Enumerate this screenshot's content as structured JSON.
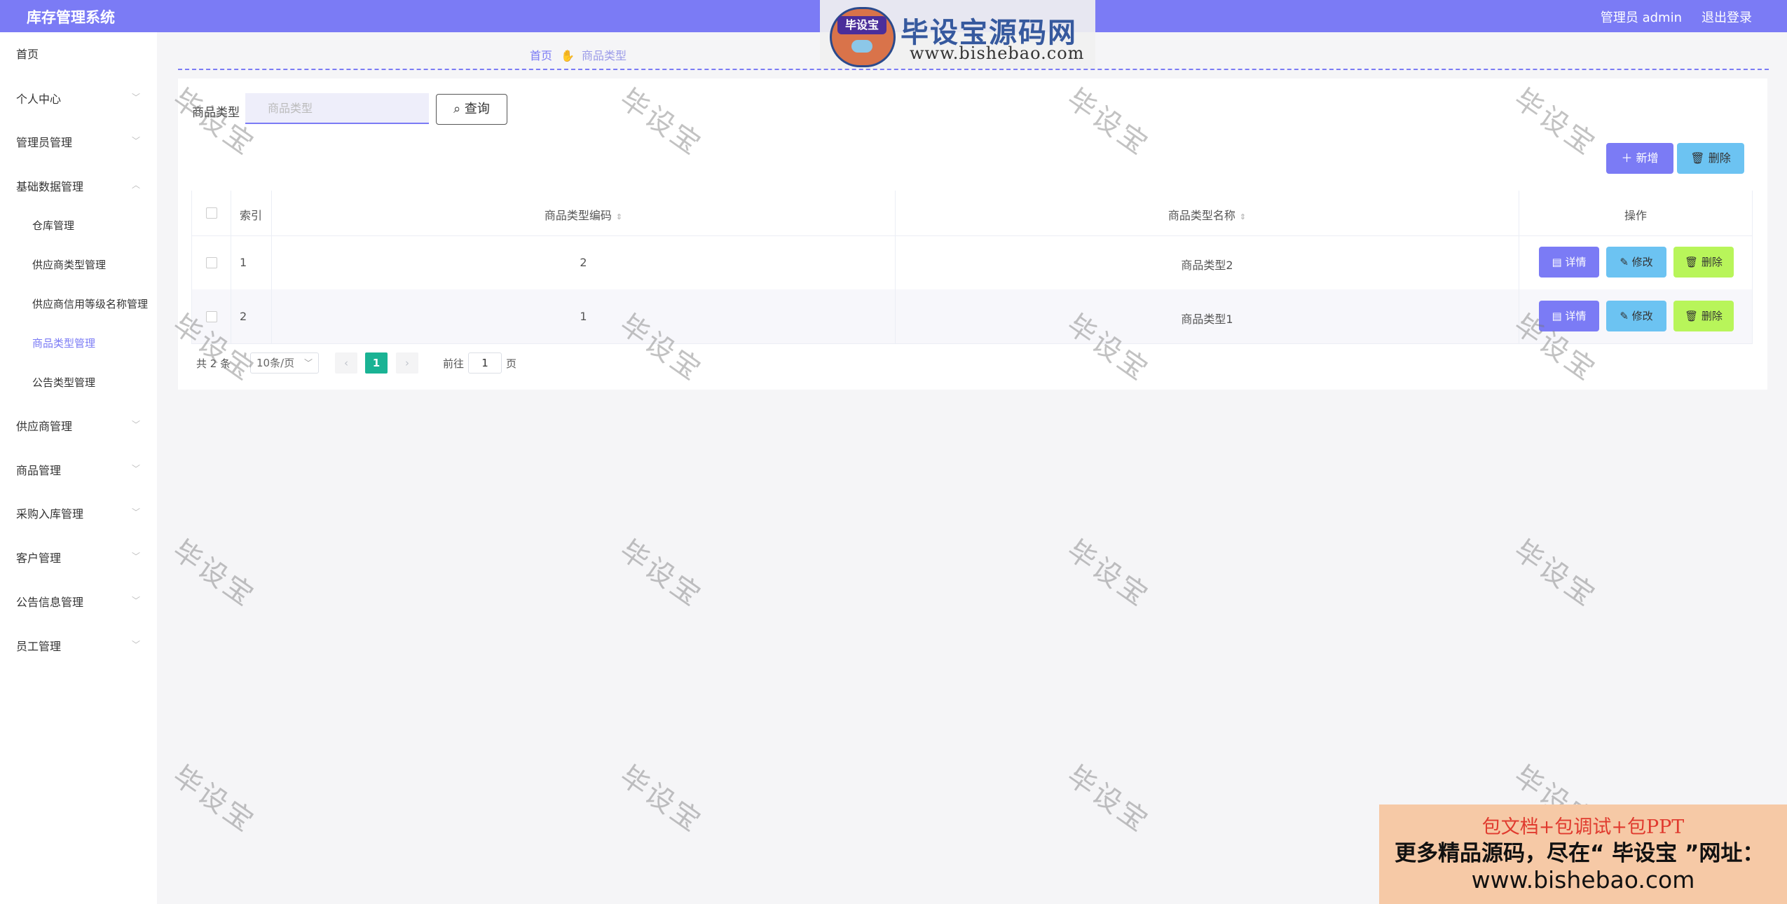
{
  "header": {
    "app_title": "库存管理系统",
    "user_label": "管理员 admin",
    "logout_label": "退出登录",
    "accent_color": "#7b7bf5"
  },
  "logo_watermark": {
    "badge": "毕设宝",
    "title": "毕设宝源码网",
    "url": "www.bishebao.com"
  },
  "sidebar": {
    "items": [
      {
        "label": "首页"
      },
      {
        "label": "个人中心"
      },
      {
        "label": "管理员管理"
      },
      {
        "label": "基础数据管理"
      },
      {
        "label": "供应商管理"
      },
      {
        "label": "商品管理"
      },
      {
        "label": "采购入库管理"
      },
      {
        "label": "客户管理"
      },
      {
        "label": "公告信息管理"
      },
      {
        "label": "员工管理"
      }
    ],
    "subitems": [
      {
        "label": "仓库管理"
      },
      {
        "label": "供应商类型管理"
      },
      {
        "label": "供应商信用等级名称管理"
      },
      {
        "label": "商品类型管理"
      },
      {
        "label": "公告类型管理"
      }
    ]
  },
  "breadcrumb": {
    "home": "首页",
    "current": "商品类型"
  },
  "search": {
    "label": "商品类型",
    "placeholder": "商品类型",
    "query_button": "查询"
  },
  "actions": {
    "add_label": "新增",
    "delete_label": "删除"
  },
  "table": {
    "columns": [
      "索引",
      "商品类型编码",
      "商品类型名称",
      "操作"
    ],
    "rows": [
      {
        "index": "1",
        "code": "2",
        "name": "商品类型2"
      },
      {
        "index": "2",
        "code": "1",
        "name": "商品类型1"
      }
    ],
    "row_actions": {
      "detail": "详情",
      "edit": "修改",
      "delete": "删除"
    }
  },
  "pagination": {
    "total": "共 2 条",
    "page_size": "10条/页",
    "current_page": "1",
    "goto_label": "前往",
    "goto_value": "1",
    "goto_suffix": "页"
  },
  "watermark_text": "毕设宝",
  "ad": {
    "line1": "包文档+包调试+包PPT",
    "line2": "更多精品源码，尽在“ 毕设宝 ”网址：",
    "line3": "www.bishebao.com"
  }
}
